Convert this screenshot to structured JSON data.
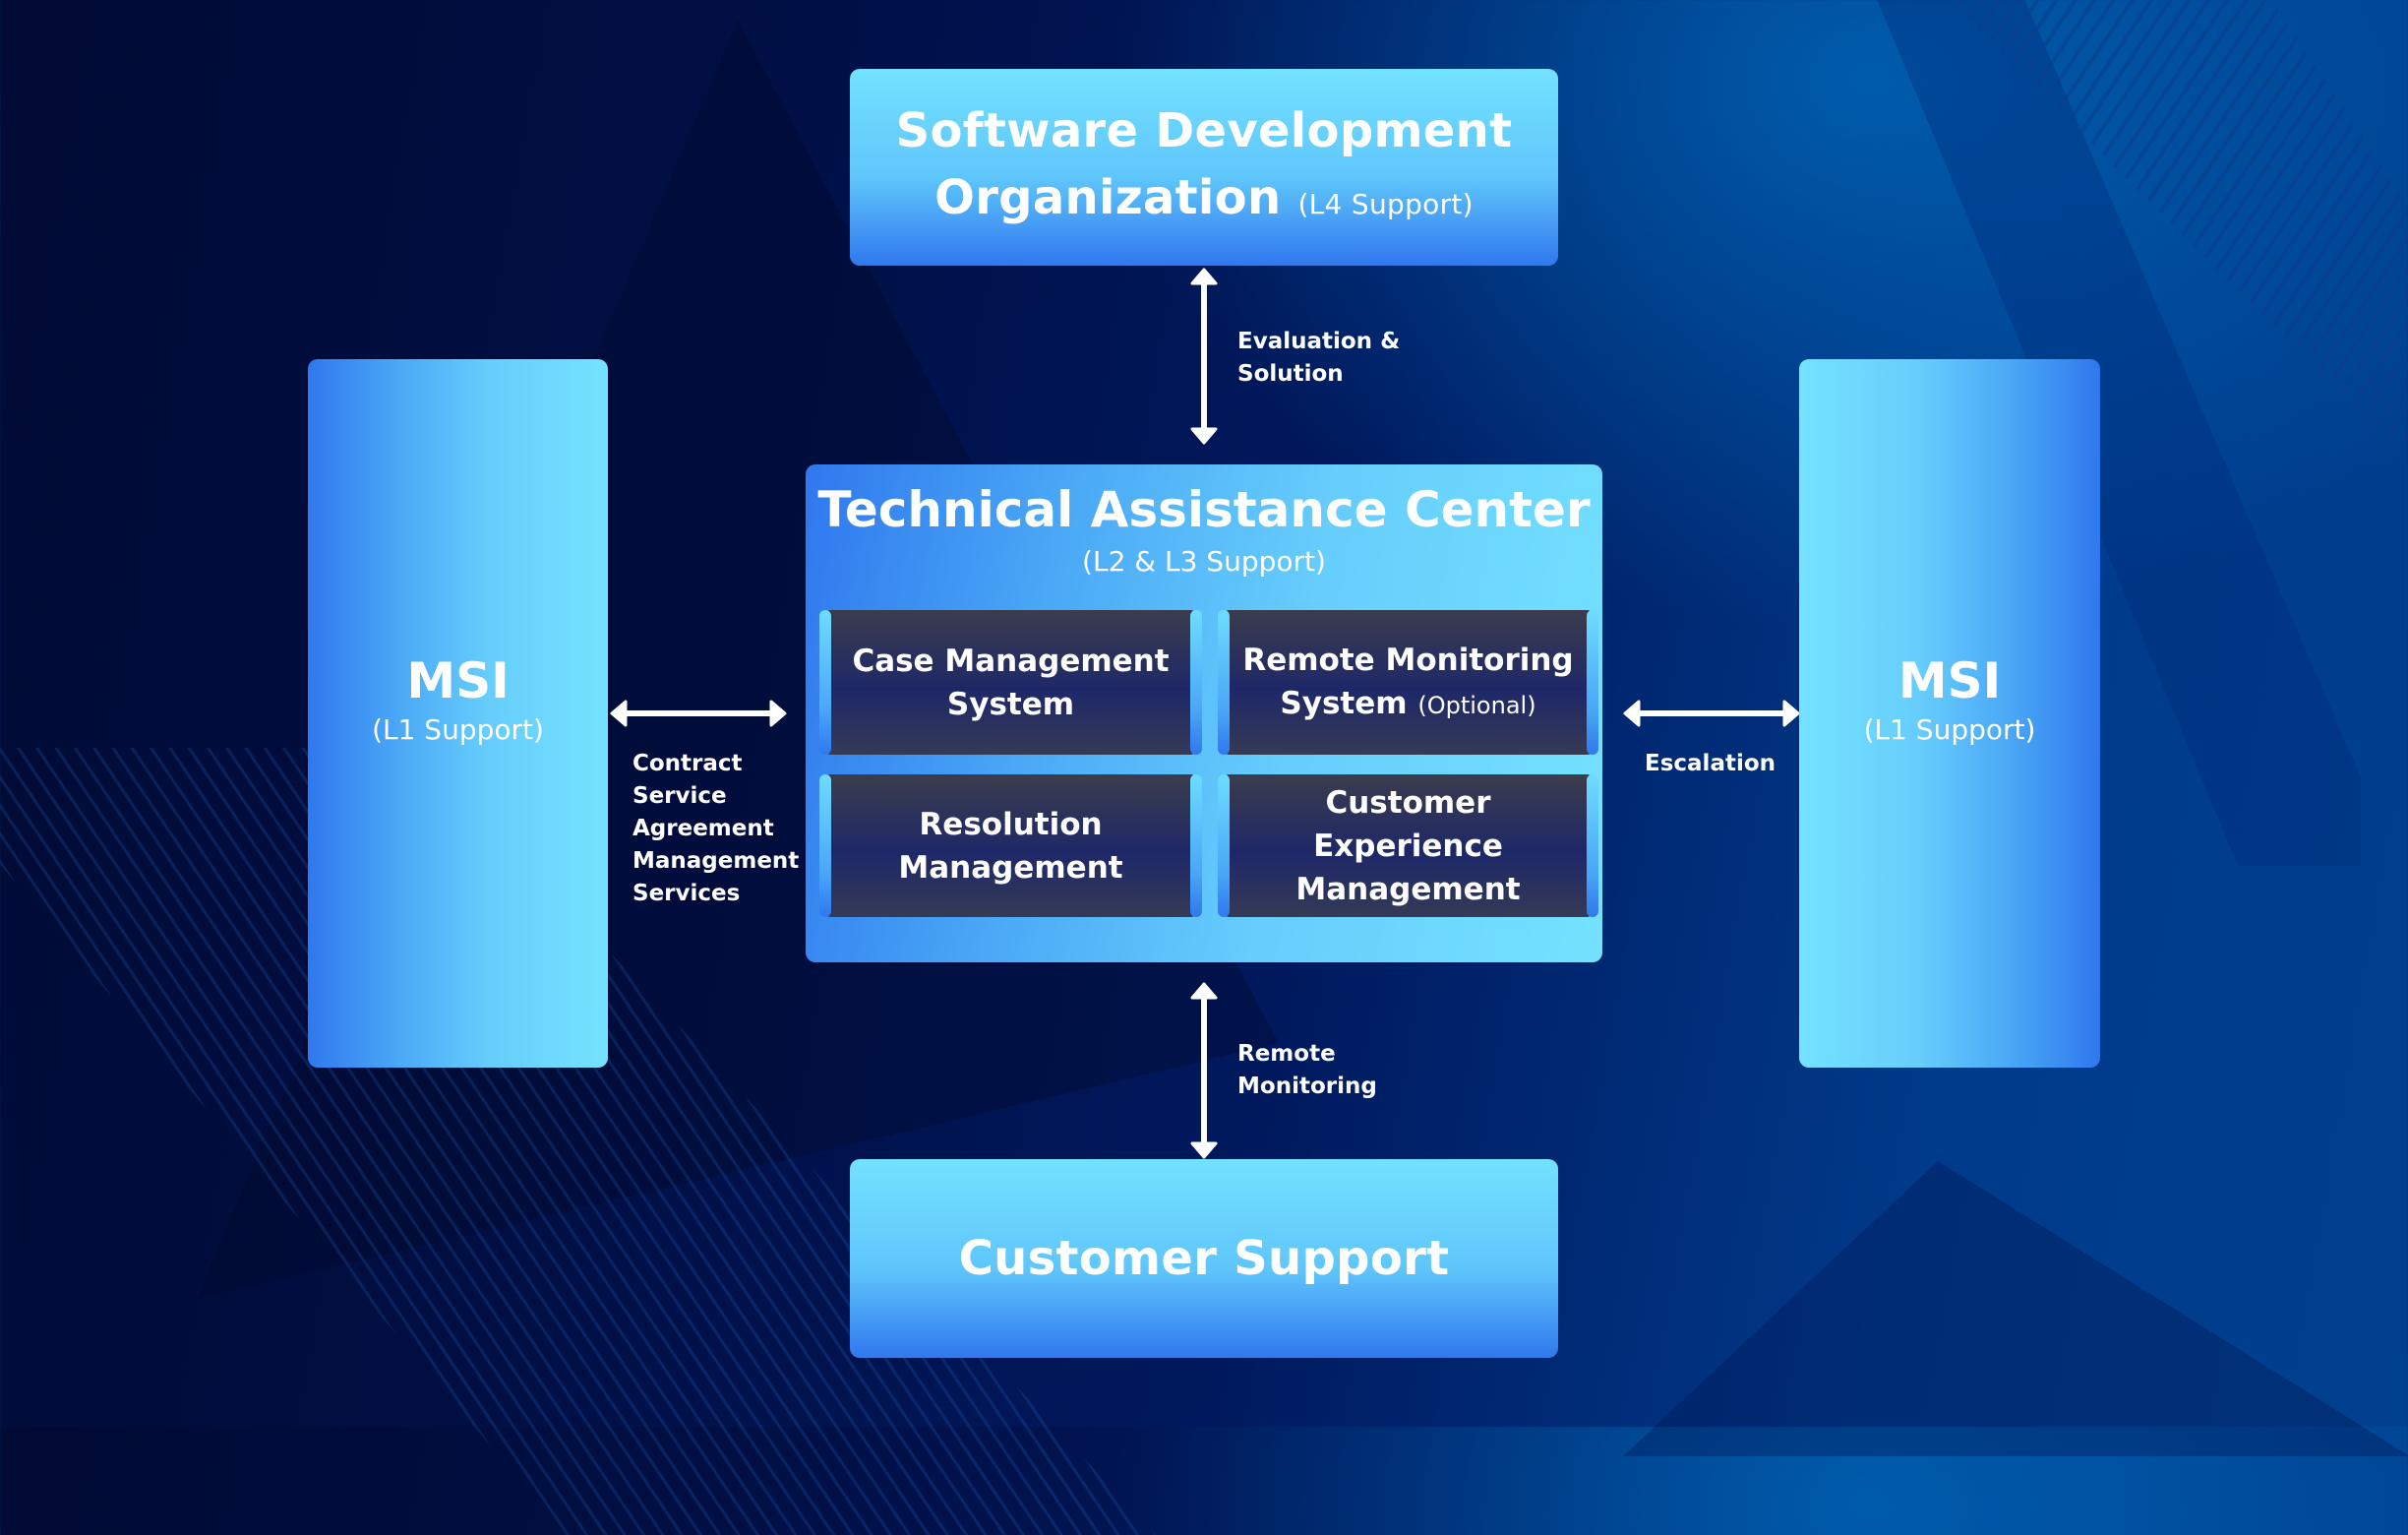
{
  "diagram": {
    "top_box": {
      "title_line1": "Software Development",
      "title_line2": "Organization",
      "suffix": "(L4 Support)"
    },
    "center_box": {
      "title": "Technical Assistance Center",
      "subtitle": "(L2 & L3 Support)",
      "modules": [
        {
          "line1": "Case Management",
          "line2": "System",
          "note": ""
        },
        {
          "line1": "Remote Monitoring",
          "line2": "System",
          "note": "(Optional)"
        },
        {
          "line1": "Resolution",
          "line2": "Management",
          "note": ""
        },
        {
          "line1": "Customer",
          "line2": "Experience",
          "line3": "Management"
        }
      ]
    },
    "left_box": {
      "title": "MSI",
      "subtitle": "(L1 Support)"
    },
    "right_box": {
      "title": "MSI",
      "subtitle": "(L1 Support)"
    },
    "bottom_box": {
      "title": "Customer Support"
    },
    "connections": {
      "top": {
        "from": "Technical Assistance Center",
        "to": "Software Development Organization",
        "direction": "bidirectional",
        "label_line1": "Evaluation &",
        "label_line2": "Solution"
      },
      "bottom": {
        "from": "Technical Assistance Center",
        "to": "Customer Support",
        "direction": "bidirectional",
        "label_line1": "Remote",
        "label_line2": "Monitoring"
      },
      "left": {
        "from": "MSI (left)",
        "to": "Technical Assistance Center",
        "direction": "bidirectional",
        "label_lines": [
          "Contract",
          "Service",
          "Agreement",
          "Management",
          "Services"
        ]
      },
      "right": {
        "from": "Technical Assistance Center",
        "to": "MSI (right)",
        "direction": "bidirectional",
        "label": "Escalation"
      }
    },
    "colors": {
      "background_dark": "#000a33",
      "background_light": "#0060b0",
      "box_light": "#74e2ff",
      "box_dark": "#2f78ee",
      "card_dark": "#1e2868",
      "text": "#ffffff",
      "arrow": "#ffffff"
    }
  }
}
